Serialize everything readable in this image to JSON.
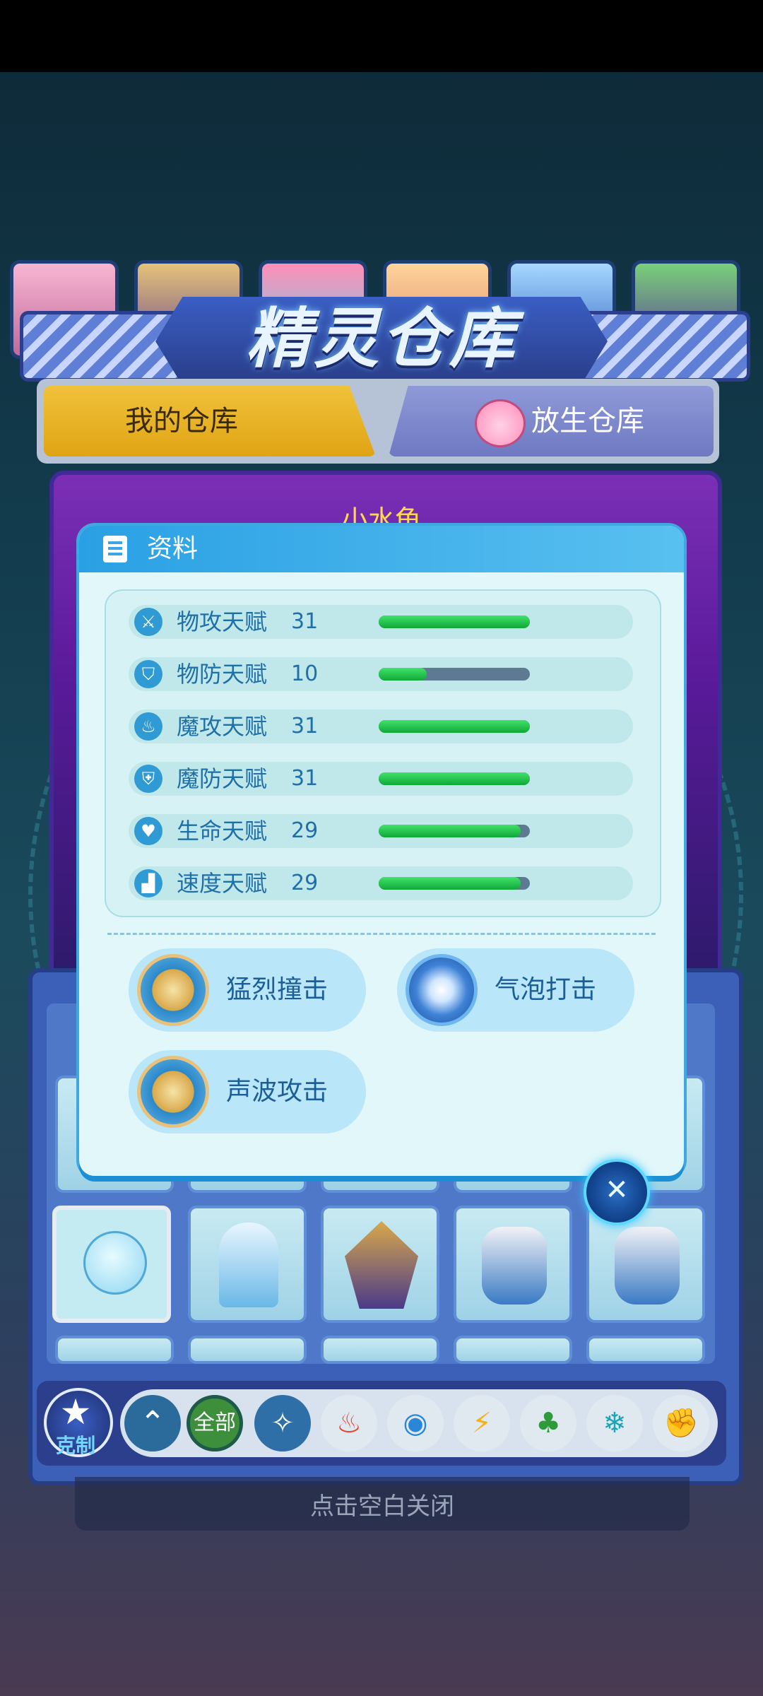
{
  "title": "精灵仓库",
  "tabs": {
    "mine": "我的仓库",
    "release": "放生仓库"
  },
  "pet_name": "小水龟",
  "modal": {
    "title": "资料",
    "stats": [
      {
        "icon": "sword-icon",
        "label": "物攻天赋",
        "value": "31",
        "fill": 1.0
      },
      {
        "icon": "shield-icon",
        "label": "物防天赋",
        "value": "10",
        "fill": 0.32
      },
      {
        "icon": "fire-icon",
        "label": "魔攻天赋",
        "value": "31",
        "fill": 1.0
      },
      {
        "icon": "magic-shield-icon",
        "label": "魔防天赋",
        "value": "31",
        "fill": 1.0
      },
      {
        "icon": "heart-plus-icon",
        "label": "生命天赋",
        "value": "29",
        "fill": 0.94
      },
      {
        "icon": "boot-icon",
        "label": "速度天赋",
        "value": "29",
        "fill": 0.94
      }
    ],
    "skills": [
      {
        "name": "猛烈撞击",
        "icon": "gold-cross-skill-icon"
      },
      {
        "name": "气泡打击",
        "icon": "blue-swirl-skill-icon"
      },
      {
        "name": "声波攻击",
        "icon": "gold-cross-skill-icon"
      }
    ]
  },
  "filter": {
    "counter_label": "克制",
    "all_label": "全部",
    "elements": [
      "normal-icon",
      "fire-icon",
      "water-icon",
      "electric-icon",
      "grass-icon",
      "ice-icon",
      "fighting-icon"
    ]
  },
  "close_hint": "点击空白关闭",
  "colors": {
    "stat_fill": "#1fc046",
    "modal_header": "#2aa0e4",
    "tab_active": "#f0c23a"
  }
}
